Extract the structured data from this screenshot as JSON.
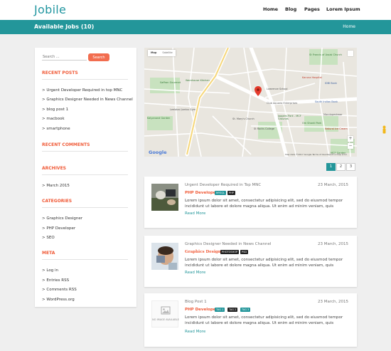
{
  "header": {
    "logo": "Jobile",
    "nav": [
      "Home",
      "Blog",
      "Pages",
      "Lorem Ipsum"
    ]
  },
  "banner": {
    "title": "Available Jobs (10)",
    "breadcrumb": "Home"
  },
  "sidebar": {
    "search_placeholder": "Search ...",
    "search_button": "Search",
    "recent_posts_heading": "RECENT POSTS",
    "recent_posts": [
      "Urgent Developer Required in top MNC",
      "Graphics Designer Needed in News Channel",
      "blog post 1",
      "macbook",
      "smartphone"
    ],
    "recent_comments_heading": "RECENT COMMENTS",
    "archives_heading": "ARCHIVES",
    "archives": [
      "March 2015"
    ],
    "categories_heading": "CATEGORIES",
    "categories": [
      "Graphics Designer",
      "PHP Developer",
      "SEO"
    ],
    "meta_heading": "META",
    "meta": [
      "Log in",
      "Entries RSS",
      "Comments RSS",
      "WordPress.org"
    ]
  },
  "map": {
    "tabs": [
      "Map",
      "Satellite"
    ],
    "labels": {
      "saffron": "Saffron Gourmet",
      "warehouse": "Warehouse Kitchen",
      "kalyanand": "Kalyanand Garden",
      "leelabai": "Leelabai Jumbo Gym",
      "stfrancis": "St Francis of Assisi Church",
      "karuna": "Karuna Hospital",
      "idbi": "IDBI Bank",
      "southindian": "South Indian Bank",
      "lawrence": "Lawrence School",
      "aquaria": "Club Aquaria Enterprises",
      "stmary": "St. Mary's Church",
      "strocks": "St Rocks College",
      "joggers": "Joggers Park - MCF Grounds",
      "omshanti": "Om Shanti Park",
      "mandapeshwar": "Mandapeshwar",
      "naturalice": "Natural Ice Cream",
      "mcf": "MCF Garden"
    },
    "google": "Google",
    "footer": "Map data ©2017 Google   Terms of Use   Report a map error"
  },
  "pagination": [
    "1",
    "2",
    "3"
  ],
  "jobs": [
    {
      "title": "Urgent Developer Required in Top MNC",
      "date": "23 March, 2015",
      "category": "PHP Developer",
      "tags": [
        "MYSQL",
        "PHP"
      ],
      "excerpt": "Lorem ipsum dolor sit amet, consectetur adipisicing elit, sed do eiusmod tempor incididunt ut labore et dolore magna aliqua. Ut enim ad minim veniam, quis",
      "read_more": "Read More"
    },
    {
      "title": "Graphics Designer Needed in News Channel",
      "date": "23 March, 2015",
      "category": "Graphics Designer",
      "tags": [
        "PHOTOSHOP",
        "PSD"
      ],
      "excerpt": "Lorem ipsum dolor sit amet, consectetur adipisicing elit, sed do eiusmod tempor incididunt ut labore et dolore magna aliqua. Ut enim ad minim veniam, quis",
      "read_more": "Read More"
    },
    {
      "title": "Blog Post 1",
      "date": "23 March, 2015",
      "category": "PHP Developer",
      "tags": [
        "TAG 1",
        "TAG 2",
        "TAG 3"
      ],
      "excerpt": "Lorem ipsum dolor sit amet, consectetur adipisicing elit, sed do eiusmod tempor incididunt ut labore et dolore magna aliqua. Ut enim ad minim veniam, quis",
      "read_more": "Read More",
      "no_image_text": "NO IMAGE AVAILABLE"
    }
  ],
  "colors": {
    "brand": "#23969a",
    "accent": "#f05a37",
    "button": "#f26d4f",
    "dark_tag": "#222222"
  }
}
